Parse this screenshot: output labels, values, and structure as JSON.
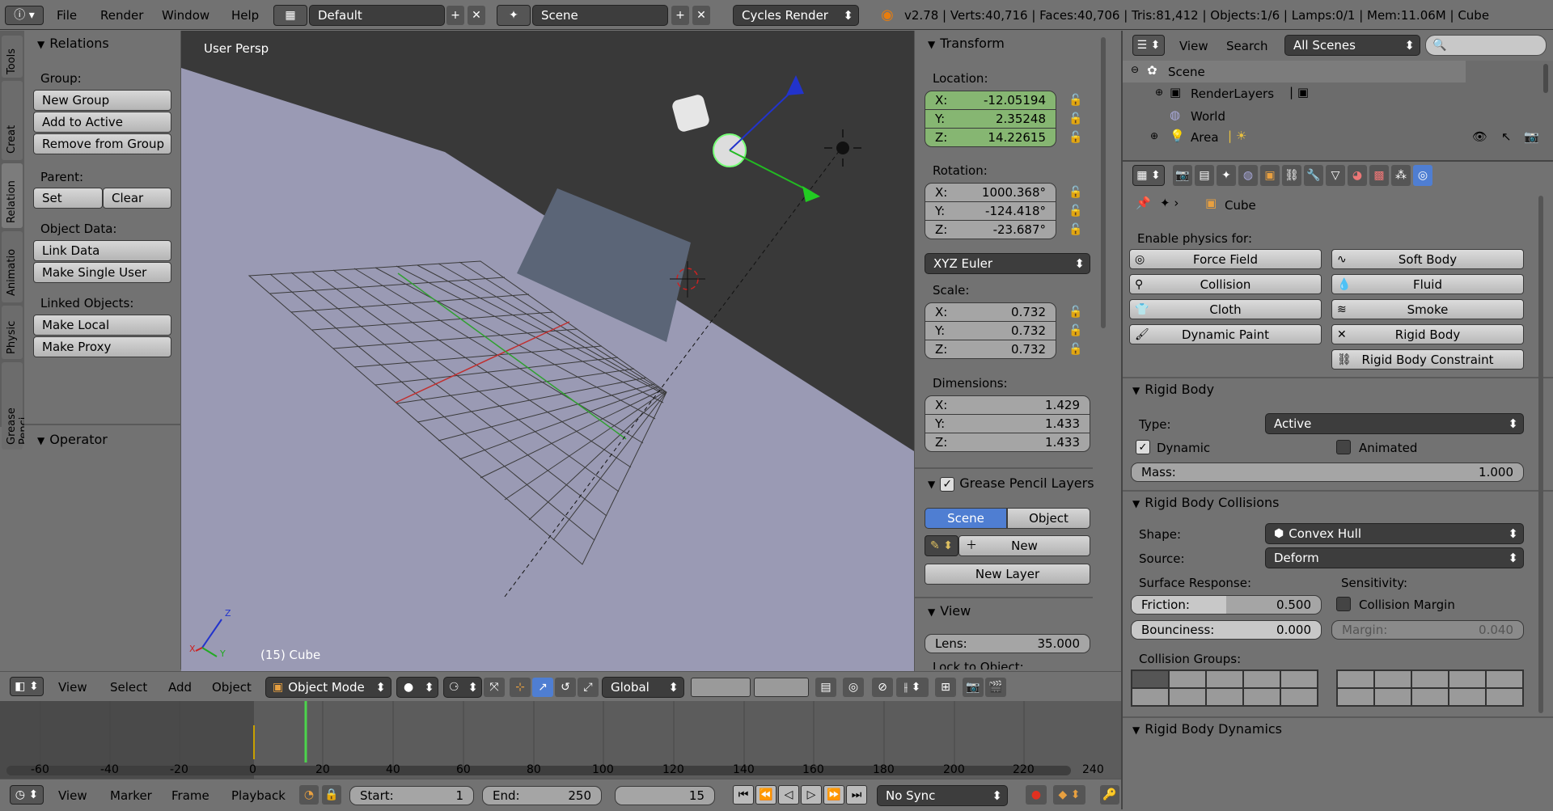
{
  "topbar": {
    "menus": [
      "File",
      "Render",
      "Window",
      "Help"
    ],
    "layout": "Default",
    "scene": "Scene",
    "engine": "Cycles Render",
    "stats": "v2.78 | Verts:40,716 | Faces:40,706 | Tris:81,412 | Objects:1/6 | Lamps:0/1 | Mem:11.06M | Cube"
  },
  "tool_tabs": [
    "Tools",
    "Creat",
    "Relation",
    "Animatio",
    "Physic",
    "Grease Penci"
  ],
  "relations": {
    "title": "Relations",
    "group_label": "Group:",
    "new_group": "New Group",
    "add_to_active": "Add to Active",
    "remove_from_group": "Remove from Group",
    "parent_label": "Parent:",
    "set": "Set",
    "clear": "Clear",
    "object_data_label": "Object Data:",
    "link_data": "Link Data",
    "make_single_user": "Make Single User",
    "linked_label": "Linked Objects:",
    "make_local": "Make Local",
    "make_proxy": "Make Proxy"
  },
  "operator": {
    "title": "Operator"
  },
  "viewport": {
    "persp_label": "User Persp",
    "object_label": "(15) Cube",
    "axis_x": "X",
    "axis_y": "Y",
    "axis_z": "Z"
  },
  "transform": {
    "title": "Transform",
    "location_label": "Location:",
    "location": [
      {
        "axis": "X:",
        "value": "-12.05194"
      },
      {
        "axis": "Y:",
        "value": "2.35248"
      },
      {
        "axis": "Z:",
        "value": "14.22615"
      }
    ],
    "rotation_label": "Rotation:",
    "rotation": [
      {
        "axis": "X:",
        "value": "1000.368°"
      },
      {
        "axis": "Y:",
        "value": "-124.418°"
      },
      {
        "axis": "Z:",
        "value": "-23.687°"
      }
    ],
    "rotation_mode": "XYZ Euler",
    "scale_label": "Scale:",
    "scale": [
      {
        "axis": "X:",
        "value": "0.732"
      },
      {
        "axis": "Y:",
        "value": "0.732"
      },
      {
        "axis": "Z:",
        "value": "0.732"
      }
    ],
    "dimensions_label": "Dimensions:",
    "dimensions": [
      {
        "axis": "X:",
        "value": "1.429"
      },
      {
        "axis": "Y:",
        "value": "1.433"
      },
      {
        "axis": "Z:",
        "value": "1.433"
      }
    ]
  },
  "grease": {
    "title": "Grease Pencil Layers",
    "scene_tab": "Scene",
    "object_tab": "Object",
    "new": "New",
    "new_layer": "New Layer"
  },
  "view": {
    "title": "View",
    "lens_label": "Lens:",
    "lens_value": "35.000",
    "lock_label": "Lock to Object:"
  },
  "viewport_header": {
    "menus": [
      "View",
      "Select",
      "Add",
      "Object"
    ],
    "mode": "Object Mode",
    "orientation": "Global"
  },
  "timeline": {
    "ticks": [
      "-60",
      "-40",
      "-20",
      "0",
      "20",
      "40",
      "60",
      "80",
      "100",
      "120",
      "140",
      "160",
      "180",
      "200",
      "220",
      "240"
    ],
    "menus": [
      "View",
      "Marker",
      "Frame",
      "Playback"
    ],
    "start_label": "Start:",
    "start_value": "1",
    "end_label": "End:",
    "end_value": "250",
    "current": "15",
    "sync": "No Sync"
  },
  "outliner": {
    "menus": [
      "View",
      "Search"
    ],
    "scope": "All Scenes",
    "items": [
      "Scene",
      "RenderLayers",
      "World",
      "Area"
    ]
  },
  "properties": {
    "object_name": "Cube",
    "enable_label": "Enable physics for:",
    "physics": [
      [
        "Force Field",
        "Soft Body"
      ],
      [
        "Collision",
        "Fluid"
      ],
      [
        "Cloth",
        "Smoke"
      ],
      [
        "Dynamic Paint",
        "Rigid Body"
      ],
      [
        "",
        "Rigid Body Constraint"
      ]
    ],
    "rigid_body": {
      "title": "Rigid Body",
      "type_label": "Type:",
      "type_value": "Active",
      "dynamic": "Dynamic",
      "animated": "Animated",
      "mass_label": "Mass:",
      "mass_value": "1.000"
    },
    "collisions": {
      "title": "Rigid Body Collisions",
      "shape_label": "Shape:",
      "shape_value": "Convex Hull",
      "source_label": "Source:",
      "source_value": "Deform",
      "surface_label": "Surface Response:",
      "sensitivity_label": "Sensitivity:",
      "friction_label": "Friction:",
      "friction_value": "0.500",
      "friction_fill": 0.5,
      "bounciness_label": "Bounciness:",
      "bounciness_value": "0.000",
      "collision_margin": "Collision Margin",
      "margin_label": "Margin:",
      "margin_value": "0.040",
      "groups_label": "Collision Groups:"
    },
    "dynamics": {
      "title": "Rigid Body Dynamics"
    }
  },
  "colors": {
    "accent": "#4f7ed2",
    "green_field": "#86b672",
    "viewport_dark": "#393939",
    "floor": "#9a9ab4"
  }
}
